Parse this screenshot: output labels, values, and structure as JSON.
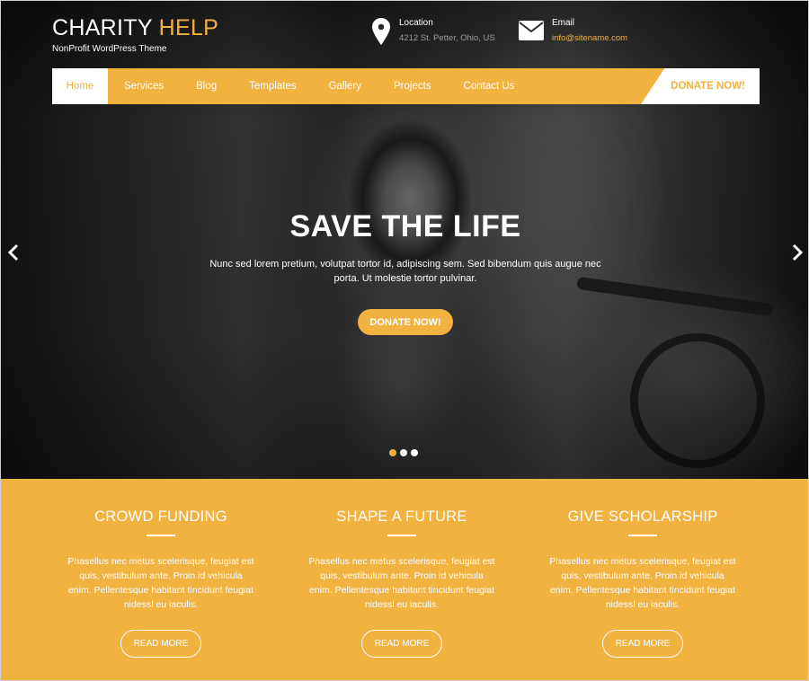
{
  "brand": {
    "title_main": "CHARITY",
    "title_accent": "HELP",
    "subtitle": "NonProfit WordPress Theme"
  },
  "location": {
    "label": "Location",
    "value": "4212 St. Petter, Ohio, US",
    "icon": "map-pin-icon"
  },
  "email": {
    "label": "Email",
    "value": "info@sitename.com",
    "icon": "envelope-icon"
  },
  "nav": {
    "items": [
      {
        "label": "Home",
        "active": true
      },
      {
        "label": "Services"
      },
      {
        "label": "Blog"
      },
      {
        "label": "Templates"
      },
      {
        "label": "Gallery"
      },
      {
        "label": "Projects"
      },
      {
        "label": "Contact Us"
      }
    ],
    "donate_label": "DONATE NOW!"
  },
  "hero": {
    "title": "SAVE THE LIFE",
    "text": "Nunc sed lorem pretium, volutpat tortor id, adipiscing sem. Sed bibendum quis augue nec porta. Ut molestie tortor pulvinar.",
    "button_label": "DONATE NOW!",
    "slides_total": 3,
    "active_slide": 1
  },
  "features": [
    {
      "title": "CROWD FUNDING",
      "text": "Phasellus nec metus scelerisque, feugiat est quis, vestibulum ante. Proin id vehicula enim. Pellentesque habitant tincidunt feugiat nidessl eu iaculis.",
      "button_label": "READ MORE"
    },
    {
      "title": "SHAPE A FUTURE",
      "text": "Phasellus nec metus scelerisque, feugiat est quis, vestibulum ante. Proin id vehicula enim. Pellentesque habitant tincidunt feugiat nidessl eu iaculis.",
      "button_label": "READ MORE"
    },
    {
      "title": "GIVE SCHOLARSHIP",
      "text": "Phasellus nec metus scelerisque, feugiat est quis, vestibulum ante. Proin id vehicula enim. Pellentesque habitant tincidunt feugiat nidessl eu iaculis.",
      "button_label": "READ MORE"
    }
  ],
  "colors": {
    "accent": "#f2b23f",
    "white": "#ffffff",
    "muted_text": "#9b9b9b"
  }
}
